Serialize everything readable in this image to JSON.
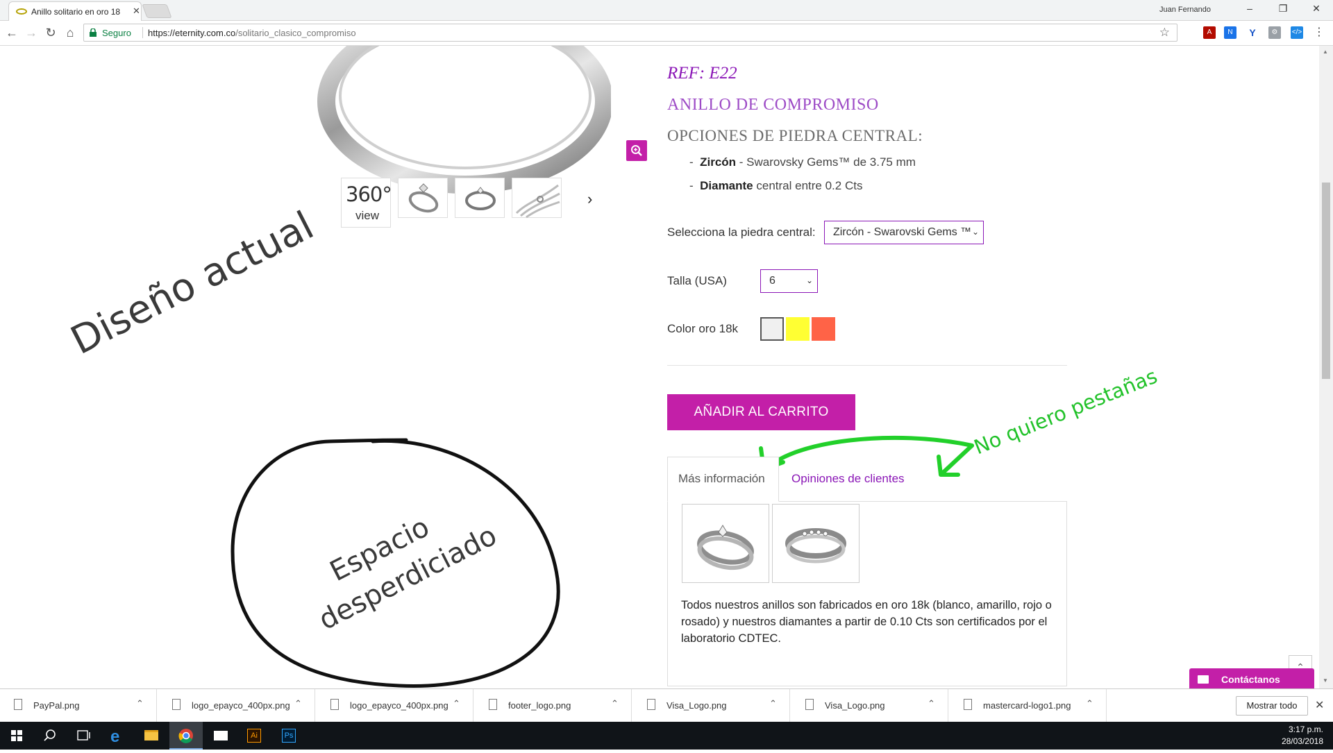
{
  "browser": {
    "tab_title": "Anillo solitario en oro 18",
    "profile_name": "Juan Fernando",
    "secure_label": "Seguro",
    "url_host": "https://eternity.com.co",
    "url_path": "/solitario_clasico_compromiso",
    "window_buttons": [
      "–",
      "❐",
      "✕"
    ]
  },
  "gallery": {
    "thumb_360_number": "360°",
    "thumb_360_label": "view"
  },
  "product": {
    "ref": "REF: E22",
    "name": "ANILLO DE COMPROMISO",
    "options_title": "OPCIONES DE PIEDRA CENTRAL:",
    "options": [
      {
        "bold": "Zircón",
        "rest": " - Swarovsky Gems™ de 3.75 mm"
      },
      {
        "bold": "Diamante",
        "rest": " central entre 0.2 Cts"
      }
    ],
    "stone_label": "Selecciona la piedra central:",
    "stone_value": "Zircón - Swarovski Gems ™",
    "size_label": "Talla (USA)",
    "size_value": "6",
    "color_label": "Color oro 18k",
    "color_swatches": [
      "#f0f0f0",
      "#ffff33",
      "#ff6347"
    ],
    "add_to_cart": "AÑADIR AL CARRITO",
    "tabs": [
      "Más información",
      "Opiniones de clientes"
    ],
    "info_text": "Todos nuestros anillos son fabricados en oro 18k (blanco, amarillo, rojo o rosado) y nuestros diamantes a partir de 0.10 Cts son certificados por el laboratorio CDTEC."
  },
  "annotations": {
    "current_design": "Diseño actual",
    "wasted_space_1": "Espacio",
    "wasted_space_2": "desperdiciado",
    "no_tabs": "No quiero  pestañas"
  },
  "widgets": {
    "contact": "Contáctanos",
    "back_to_top": "⌃"
  },
  "downloads": {
    "items": [
      "PayPal.png",
      "logo_epayco_400px.png",
      "logo_epayco_400px.png",
      "footer_logo.png",
      "Visa_Logo.png",
      "Visa_Logo.png",
      "mastercard-logo1.png"
    ],
    "show_all": "Mostrar todo"
  },
  "taskbar": {
    "time": "3:17 p.m.",
    "date": "28/03/2018"
  },
  "colors": {
    "brand_magenta": "#c31fa8",
    "brand_purple": "#8a15b6",
    "annotation_green": "#22c22a"
  }
}
